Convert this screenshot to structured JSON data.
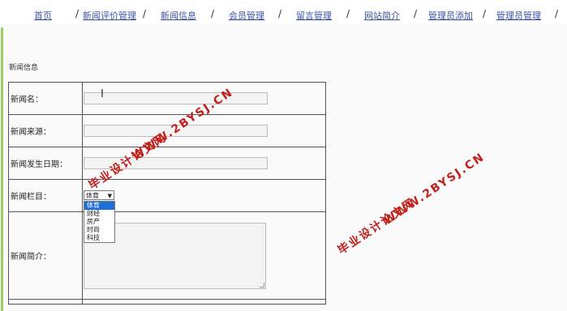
{
  "nav": {
    "items": [
      "首页",
      "新闻评价管理",
      "新闻信息",
      "会员管理",
      "留言管理",
      "网站简介",
      "管理员添加",
      "管理员管理"
    ],
    "separator": "/"
  },
  "section": {
    "title": "新闻信息"
  },
  "form": {
    "name_label": "新闻名：",
    "source_label": "新闻来源：",
    "date_label": "新闻发生日期：",
    "category_label": "新闻栏目：",
    "intro_label": "新闻简介：",
    "category_selected": "体育",
    "category_options": [
      "体育",
      "财经",
      "房产",
      "时尚",
      "科技"
    ]
  },
  "watermarks": {
    "site": "WWW.2BYSJ.CN",
    "name": "毕业设计论文网"
  },
  "colors": {
    "nav_link": "#3a52a8",
    "left_bar": "#9ccc65",
    "watermark": "#c0201c",
    "selected_option": "#1e6fd9"
  }
}
